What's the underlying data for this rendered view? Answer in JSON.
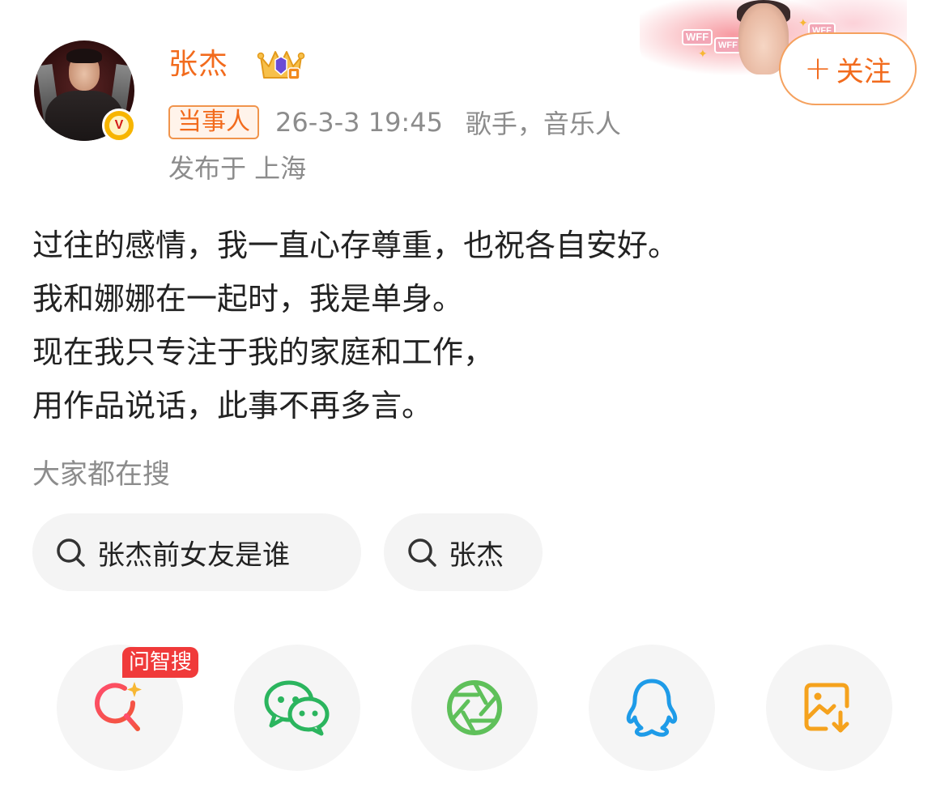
{
  "header": {
    "name": "张杰",
    "follow_label": "关注",
    "follow_plus": "+",
    "badge": "当事人",
    "time": "26-3-3 19:45",
    "bio": "歌手，音乐人",
    "location": "发布于 上海",
    "verified_mark": "V",
    "banner_tag": "WFF"
  },
  "post": {
    "lines": [
      "过往的感情，我一直心存尊重，也祝各自安好。",
      "我和娜娜在一起时，我是单身。",
      "现在我只专注于我的家庭和工作，",
      "用作品说话，此事不再多言。"
    ]
  },
  "search": {
    "title": "大家都在搜",
    "chips": [
      "张杰前女友是谁",
      "张杰"
    ]
  },
  "share": {
    "badge": "问智搜",
    "icons": [
      "zhisou-search-icon",
      "wechat-icon",
      "moments-icon",
      "qq-icon",
      "save-image-icon"
    ]
  },
  "colors": {
    "accent": "#f26b1d",
    "gray_text": "#8c8c8c",
    "chip_bg": "#f4f4f4",
    "wechat_green": "#2bb55e",
    "moments_green": "#5fc05a",
    "qq_blue": "#1e9be8",
    "save_orange": "#f5a21d",
    "zhisou_red": "#f03a3a"
  }
}
